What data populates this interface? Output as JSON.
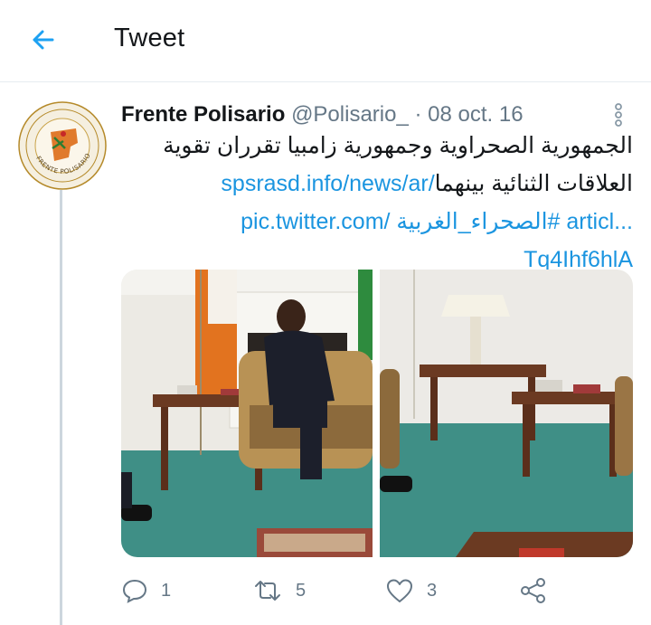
{
  "header": {
    "title": "Tweet",
    "accent_color": "#1da1f2"
  },
  "tweet": {
    "author_name": "Frente Polisario",
    "author_handle": "@Polisario_",
    "separator": " · ",
    "date": "08 oct. 16",
    "avatar_text": "FRENTE POLISARIO",
    "lines": [
      {
        "text": "الجمهورية الصحراوية وجمهورية زامبيا تقرران تقوية",
        "link": ""
      },
      {
        "text": "العلاقات الثنائية بينهما ",
        "link": "spsrasd.info/news/ar/"
      },
      {
        "text": "",
        "link": "pic.twitter.com/ الصحراء_الغربية# articl..."
      },
      {
        "text": "",
        "link": "Tq4Ihf6hlA"
      }
    ],
    "link_color": "#1b95e0"
  },
  "actions": {
    "reply_count": "1",
    "retweet_count": "5",
    "like_count": "3",
    "icons": [
      "reply-icon",
      "retweet-icon",
      "like-icon",
      "share-icon"
    ]
  }
}
